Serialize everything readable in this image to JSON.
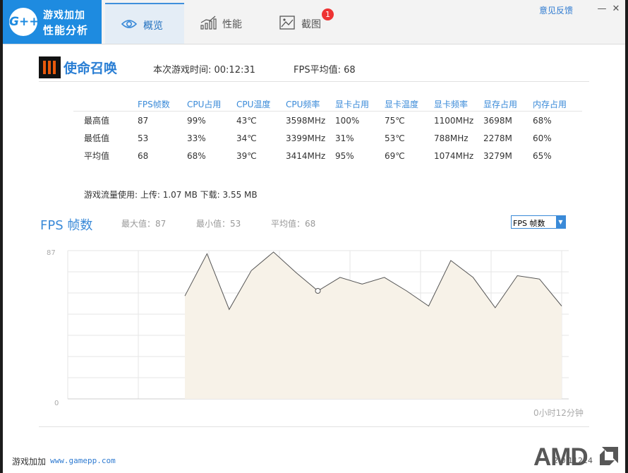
{
  "app": {
    "logo_line1": "游戏加加",
    "logo_line2": "性能分析",
    "logo_badge": "G++",
    "tabs": [
      {
        "label": "概览",
        "icon": "eye-icon",
        "active": true
      },
      {
        "label": "性能",
        "icon": "bar-chart-icon",
        "active": false
      },
      {
        "label": "截图",
        "icon": "picture-icon",
        "active": false
      }
    ],
    "screenshot_badge": "1",
    "feedback": "意见反馈"
  },
  "game": {
    "title": "使命召唤",
    "session_time_label": "本次游戏时间: 00:12:31",
    "fps_avg_label": "FPS平均值: 68"
  },
  "stats": {
    "headers": [
      "",
      "FPS帧数",
      "CPU占用",
      "CPU温度",
      "CPU频率",
      "显卡占用",
      "显卡温度",
      "显卡频率",
      "显存占用",
      "内存占用"
    ],
    "rows": [
      [
        "最高值",
        "87",
        "99%",
        "43℃",
        "3598MHz",
        "100%",
        "75℃",
        "1100MHz",
        "3698M",
        "68%"
      ],
      [
        "最低值",
        "53",
        "33%",
        "34℃",
        "3399MHz",
        "31%",
        "53℃",
        "788MHz",
        "2278M",
        "60%"
      ],
      [
        "平均值",
        "68",
        "68%",
        "39℃",
        "3414MHz",
        "95%",
        "69℃",
        "1074MHz",
        "3279M",
        "65%"
      ]
    ]
  },
  "traffic": "游戏流量使用: 上传: 1.07 MB    下载: 3.55 MB",
  "fps_section": {
    "title": "FPS 帧数",
    "max": "最大值：87",
    "min": "最小值：53",
    "avg": "平均值：68",
    "selected": "FPS 帧数"
  },
  "chart_data": {
    "type": "area",
    "ylim": [
      0,
      87
    ],
    "y_ticks": [
      "87",
      "0"
    ],
    "values": [
      61,
      86,
      53,
      76,
      87,
      75,
      64,
      72,
      68,
      72,
      64,
      55,
      82,
      72,
      54,
      73,
      71,
      55
    ],
    "highlight_index": 6,
    "x_end_label": "0小时12分钟",
    "colors": {
      "fill": "#f7f2e8",
      "line": "#555555",
      "grid": "#e6e6e6"
    }
  },
  "footer": {
    "app_name": "游戏加加",
    "url": "www.gamepp.com",
    "version": "2.0.11224",
    "amd": "AMD"
  }
}
